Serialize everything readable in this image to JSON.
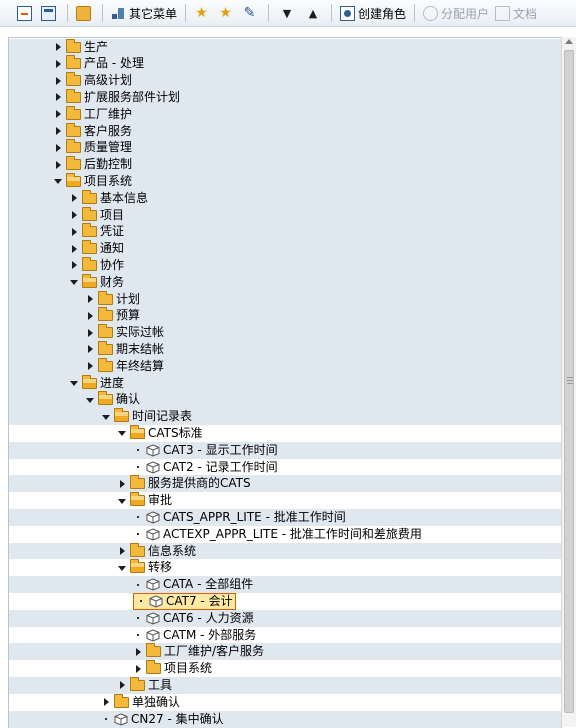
{
  "toolbar": {
    "other_menu_label": "其它菜单",
    "create_role_label": "创建角色",
    "assign_users_label": "分配用户",
    "documentation_label": "文档"
  },
  "tree": [
    {
      "label": "生产",
      "indent": 0,
      "node": "closed"
    },
    {
      "label": "产品 - 处理",
      "indent": 0,
      "node": "closed"
    },
    {
      "label": "高级计划",
      "indent": 0,
      "node": "closed"
    },
    {
      "label": "扩展服务部件计划",
      "indent": 0,
      "node": "closed"
    },
    {
      "label": "工厂维护",
      "indent": 0,
      "node": "closed"
    },
    {
      "label": "客户服务",
      "indent": 0,
      "node": "closed"
    },
    {
      "label": "质量管理",
      "indent": 0,
      "node": "closed"
    },
    {
      "label": "后勤控制",
      "indent": 0,
      "node": "closed"
    },
    {
      "label": "项目系统",
      "indent": 0,
      "node": "open"
    },
    {
      "label": "基本信息",
      "indent": 1,
      "node": "closed"
    },
    {
      "label": "项目",
      "indent": 1,
      "node": "closed"
    },
    {
      "label": "凭证",
      "indent": 1,
      "node": "closed"
    },
    {
      "label": "通知",
      "indent": 1,
      "node": "closed"
    },
    {
      "label": "协作",
      "indent": 1,
      "node": "closed"
    },
    {
      "label": "财务",
      "indent": 1,
      "node": "open"
    },
    {
      "label": "计划",
      "indent": 2,
      "node": "closed"
    },
    {
      "label": "预算",
      "indent": 2,
      "node": "closed"
    },
    {
      "label": "实际过帐",
      "indent": 2,
      "node": "closed"
    },
    {
      "label": "期末结帐",
      "indent": 2,
      "node": "closed"
    },
    {
      "label": "年终结算",
      "indent": 2,
      "node": "closed"
    },
    {
      "label": "进度",
      "indent": 1,
      "node": "open"
    },
    {
      "label": "确认",
      "indent": 2,
      "node": "open"
    },
    {
      "label": "时间记录表",
      "indent": 3,
      "node": "open"
    },
    {
      "label": "CATS标准",
      "indent": 4,
      "node": "open"
    },
    {
      "label": "CAT3 - 显示工作时间",
      "indent": 5,
      "node": "leaf"
    },
    {
      "label": "CAT2 - 记录工作时间",
      "indent": 5,
      "node": "leaf"
    },
    {
      "label": "服务提供商的CATS",
      "indent": 4,
      "node": "closed"
    },
    {
      "label": "审批",
      "indent": 4,
      "node": "open"
    },
    {
      "label": "CATS_APPR_LITE - 批准工作时间",
      "indent": 5,
      "node": "leaf"
    },
    {
      "label": "ACTEXP_APPR_LITE - 批准工作时间和差旅费用",
      "indent": 5,
      "node": "leaf"
    },
    {
      "label": "信息系统",
      "indent": 4,
      "node": "closed"
    },
    {
      "label": "转移",
      "indent": 4,
      "node": "open"
    },
    {
      "label": "CATA - 全部组件",
      "indent": 5,
      "node": "leaf"
    },
    {
      "label": "CAT7 - 会计",
      "indent": 5,
      "node": "leaf",
      "selected": true
    },
    {
      "label": "CAT6 - 人力资源",
      "indent": 5,
      "node": "leaf"
    },
    {
      "label": "CATM - 外部服务",
      "indent": 5,
      "node": "leaf"
    },
    {
      "label": "工厂维护/客户服务",
      "indent": 5,
      "node": "closed"
    },
    {
      "label": "项目系统",
      "indent": 5,
      "node": "closed"
    },
    {
      "label": "工具",
      "indent": 4,
      "node": "closed"
    },
    {
      "label": "单独确认",
      "indent": 3,
      "node": "closed"
    },
    {
      "label": "CN27 - 集中确认",
      "indent": 3,
      "node": "leaf"
    }
  ]
}
